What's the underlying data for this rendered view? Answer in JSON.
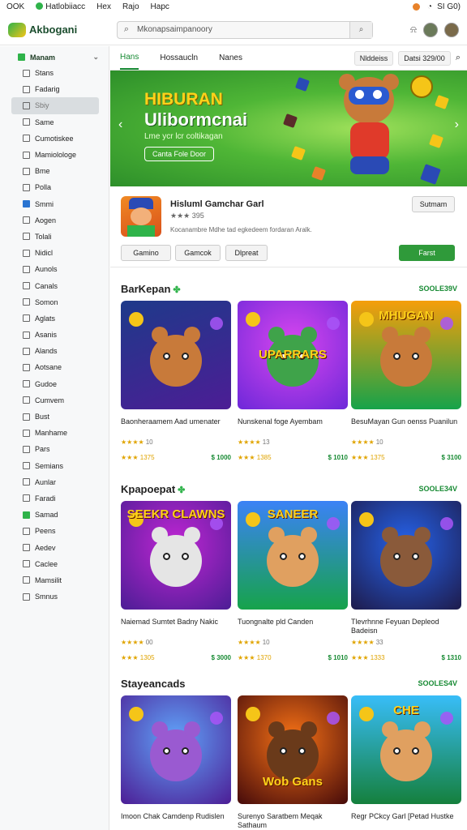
{
  "status": {
    "left": [
      "OOK",
      "Hatlobiiacc",
      "Hex",
      "Rajo",
      "Hapc"
    ],
    "right": "SI G0)"
  },
  "topbar": {
    "logo": "Akbogani",
    "search_text": "Mkonapsaimpanoory"
  },
  "sidebar": {
    "header": "Manam",
    "items": [
      "Stans",
      "Fadarig",
      "Sbiy",
      "Same",
      "Cumotiskee",
      "Mamiolologe",
      "Bme",
      "Polla",
      "Smmi",
      "Aogen",
      "Tolali",
      "Nidicl",
      "Aunols",
      "Canals",
      "Somon",
      "Aglats",
      "Asanis",
      "Alands",
      "Aotsane",
      "Gudoe",
      "Cumvem",
      "Bust",
      "Manhame",
      "Pars",
      "Semians",
      "Aunlar",
      "Faradi",
      "Samad",
      "Peens",
      "Aedev",
      "Caclee",
      "Mamsilit",
      "Smnus"
    ],
    "active": "Sbiy"
  },
  "tabs": {
    "items": [
      "Hans",
      "Hossaucln",
      "Nanes"
    ],
    "active": "Hans",
    "right_a": "Nlddeiss",
    "right_b": "Datsi 329/00"
  },
  "banner": {
    "title": "HIBURAN",
    "title2": "Ulibormcnai",
    "subtitle": "Lme ycr lcr coltikagan",
    "cta": "Canta Fole Door"
  },
  "app": {
    "name": "Hisluml Gamchar Garl",
    "rating": "★★★ 395",
    "desc": "Kocanambre Mdhe tad egkedeem fordaran Aralk.",
    "tag_a": "Gamino",
    "tag_b": "Gamcok",
    "tag_c": "Dlpreat",
    "side_btn": "Sutmam",
    "install": "Farst"
  },
  "sections": [
    {
      "title": "BarKepan",
      "link": "SOOLE39V",
      "cards": [
        {
          "title": "Baonheraamem Aad umenater",
          "stars": "★★★★",
          "count": "10",
          "rating": "★★★ 1375",
          "price": "$ 1000"
        },
        {
          "title": "Nunskenal foge Ayembam",
          "stars": "★★★★",
          "count": "13",
          "rating": "★★★ 1385",
          "price": "$ 1010"
        },
        {
          "title": "BesuMayan Gun oenss Puanilun",
          "stars": "★★★★",
          "count": "10",
          "rating": "★★★ 1375",
          "price": "$ 3100"
        }
      ]
    },
    {
      "title": "Kpapoepat",
      "link": "SOOLE34V",
      "cards": [
        {
          "title": "Naiemad Sumtet Badny Nakic",
          "stars": "★★★★",
          "count": "00",
          "rating": "★★★ 1305",
          "price": "$ 3000"
        },
        {
          "title": "Tuongnalte pld Canden",
          "stars": "★★★★",
          "count": "10",
          "rating": "★★★ 1370",
          "price": "$ 1010"
        },
        {
          "title": "Tlevrhnne Feyuan Depleod Badeisn",
          "stars": "★★★★",
          "count": "33",
          "rating": "★★★ 1333",
          "price": "$ 1310"
        }
      ]
    },
    {
      "title": "Stayeancads",
      "link": "SOOLES4V",
      "cards": [
        {
          "title": "Imoon Chak Camdenp Rudislen",
          "stars": "★★★★",
          "count": "",
          "rating": "",
          "price": ""
        },
        {
          "title": "Surenyo Saratbem Meqak Sathaum",
          "stars": "★★★★",
          "count": "",
          "rating": "",
          "price": ""
        },
        {
          "title": "Regr PCkcy Garl [Petad Hustke",
          "stars": "★★★★",
          "count": "",
          "rating": "",
          "price": ""
        }
      ]
    }
  ],
  "thumb_text": {
    "s0c1": "UPARRARS",
    "s0c2": "MHUGAN",
    "s1c0": "SEEKR CLAWNS",
    "s1c1": "SANEER",
    "s2c1": "Wob Gans",
    "s2c2": "CHE"
  },
  "colors": {
    "accent": "#178a33",
    "star": "#e0a400"
  }
}
